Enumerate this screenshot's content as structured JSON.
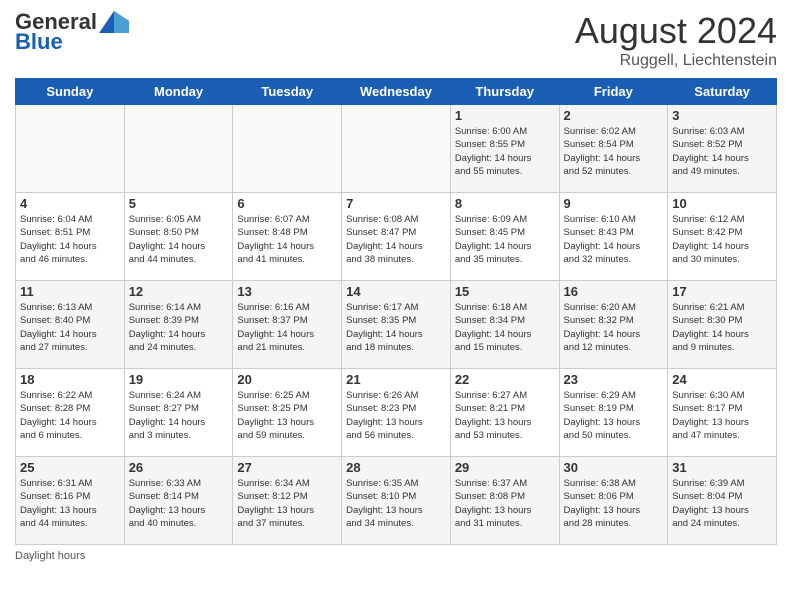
{
  "header": {
    "logo_general": "General",
    "logo_blue": "Blue",
    "month_title": "August 2024",
    "subtitle": "Ruggell, Liechtenstein"
  },
  "days_of_week": [
    "Sunday",
    "Monday",
    "Tuesday",
    "Wednesday",
    "Thursday",
    "Friday",
    "Saturday"
  ],
  "weeks": [
    [
      {
        "day": "",
        "info": ""
      },
      {
        "day": "",
        "info": ""
      },
      {
        "day": "",
        "info": ""
      },
      {
        "day": "",
        "info": ""
      },
      {
        "day": "1",
        "info": "Sunrise: 6:00 AM\nSunset: 8:55 PM\nDaylight: 14 hours\nand 55 minutes."
      },
      {
        "day": "2",
        "info": "Sunrise: 6:02 AM\nSunset: 8:54 PM\nDaylight: 14 hours\nand 52 minutes."
      },
      {
        "day": "3",
        "info": "Sunrise: 6:03 AM\nSunset: 8:52 PM\nDaylight: 14 hours\nand 49 minutes."
      }
    ],
    [
      {
        "day": "4",
        "info": "Sunrise: 6:04 AM\nSunset: 8:51 PM\nDaylight: 14 hours\nand 46 minutes."
      },
      {
        "day": "5",
        "info": "Sunrise: 6:05 AM\nSunset: 8:50 PM\nDaylight: 14 hours\nand 44 minutes."
      },
      {
        "day": "6",
        "info": "Sunrise: 6:07 AM\nSunset: 8:48 PM\nDaylight: 14 hours\nand 41 minutes."
      },
      {
        "day": "7",
        "info": "Sunrise: 6:08 AM\nSunset: 8:47 PM\nDaylight: 14 hours\nand 38 minutes."
      },
      {
        "day": "8",
        "info": "Sunrise: 6:09 AM\nSunset: 8:45 PM\nDaylight: 14 hours\nand 35 minutes."
      },
      {
        "day": "9",
        "info": "Sunrise: 6:10 AM\nSunset: 8:43 PM\nDaylight: 14 hours\nand 32 minutes."
      },
      {
        "day": "10",
        "info": "Sunrise: 6:12 AM\nSunset: 8:42 PM\nDaylight: 14 hours\nand 30 minutes."
      }
    ],
    [
      {
        "day": "11",
        "info": "Sunrise: 6:13 AM\nSunset: 8:40 PM\nDaylight: 14 hours\nand 27 minutes."
      },
      {
        "day": "12",
        "info": "Sunrise: 6:14 AM\nSunset: 8:39 PM\nDaylight: 14 hours\nand 24 minutes."
      },
      {
        "day": "13",
        "info": "Sunrise: 6:16 AM\nSunset: 8:37 PM\nDaylight: 14 hours\nand 21 minutes."
      },
      {
        "day": "14",
        "info": "Sunrise: 6:17 AM\nSunset: 8:35 PM\nDaylight: 14 hours\nand 18 minutes."
      },
      {
        "day": "15",
        "info": "Sunrise: 6:18 AM\nSunset: 8:34 PM\nDaylight: 14 hours\nand 15 minutes."
      },
      {
        "day": "16",
        "info": "Sunrise: 6:20 AM\nSunset: 8:32 PM\nDaylight: 14 hours\nand 12 minutes."
      },
      {
        "day": "17",
        "info": "Sunrise: 6:21 AM\nSunset: 8:30 PM\nDaylight: 14 hours\nand 9 minutes."
      }
    ],
    [
      {
        "day": "18",
        "info": "Sunrise: 6:22 AM\nSunset: 8:28 PM\nDaylight: 14 hours\nand 6 minutes."
      },
      {
        "day": "19",
        "info": "Sunrise: 6:24 AM\nSunset: 8:27 PM\nDaylight: 14 hours\nand 3 minutes."
      },
      {
        "day": "20",
        "info": "Sunrise: 6:25 AM\nSunset: 8:25 PM\nDaylight: 13 hours\nand 59 minutes."
      },
      {
        "day": "21",
        "info": "Sunrise: 6:26 AM\nSunset: 8:23 PM\nDaylight: 13 hours\nand 56 minutes."
      },
      {
        "day": "22",
        "info": "Sunrise: 6:27 AM\nSunset: 8:21 PM\nDaylight: 13 hours\nand 53 minutes."
      },
      {
        "day": "23",
        "info": "Sunrise: 6:29 AM\nSunset: 8:19 PM\nDaylight: 13 hours\nand 50 minutes."
      },
      {
        "day": "24",
        "info": "Sunrise: 6:30 AM\nSunset: 8:17 PM\nDaylight: 13 hours\nand 47 minutes."
      }
    ],
    [
      {
        "day": "25",
        "info": "Sunrise: 6:31 AM\nSunset: 8:16 PM\nDaylight: 13 hours\nand 44 minutes."
      },
      {
        "day": "26",
        "info": "Sunrise: 6:33 AM\nSunset: 8:14 PM\nDaylight: 13 hours\nand 40 minutes."
      },
      {
        "day": "27",
        "info": "Sunrise: 6:34 AM\nSunset: 8:12 PM\nDaylight: 13 hours\nand 37 minutes."
      },
      {
        "day": "28",
        "info": "Sunrise: 6:35 AM\nSunset: 8:10 PM\nDaylight: 13 hours\nand 34 minutes."
      },
      {
        "day": "29",
        "info": "Sunrise: 6:37 AM\nSunset: 8:08 PM\nDaylight: 13 hours\nand 31 minutes."
      },
      {
        "day": "30",
        "info": "Sunrise: 6:38 AM\nSunset: 8:06 PM\nDaylight: 13 hours\nand 28 minutes."
      },
      {
        "day": "31",
        "info": "Sunrise: 6:39 AM\nSunset: 8:04 PM\nDaylight: 13 hours\nand 24 minutes."
      }
    ]
  ],
  "footer": {
    "daylight_label": "Daylight hours"
  }
}
